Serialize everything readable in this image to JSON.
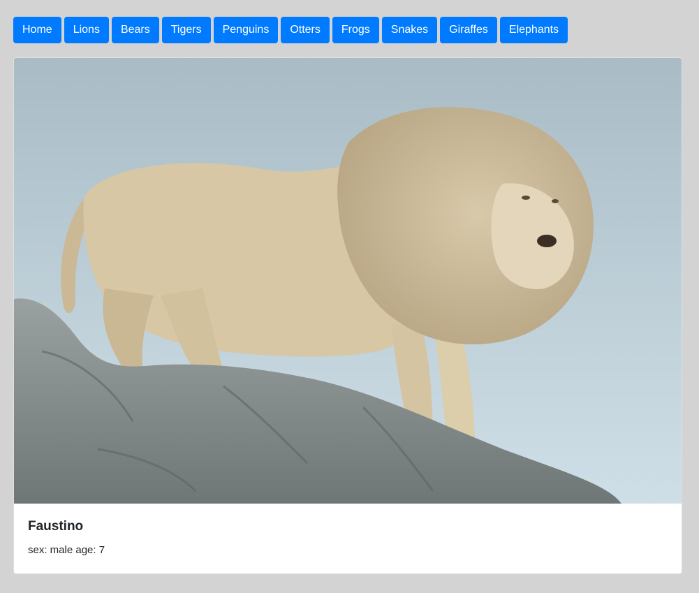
{
  "nav": {
    "items": [
      {
        "label": "Home"
      },
      {
        "label": "Lions"
      },
      {
        "label": "Bears"
      },
      {
        "label": "Tigers"
      },
      {
        "label": "Penguins"
      },
      {
        "label": "Otters"
      },
      {
        "label": "Frogs"
      },
      {
        "label": "Snakes"
      },
      {
        "label": "Giraffes"
      },
      {
        "label": "Elephants"
      }
    ]
  },
  "card": {
    "title": "Faustino",
    "text": "sex: male age: 7"
  }
}
